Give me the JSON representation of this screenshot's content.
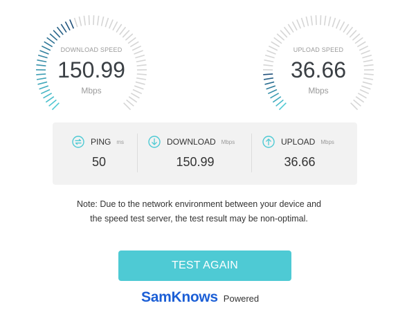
{
  "download_gauge": {
    "label": "DOWNLOAD SPEED",
    "value": "150.99",
    "unit": "Mbps",
    "fill_fraction": 0.43
  },
  "upload_gauge": {
    "label": "UPLOAD SPEED",
    "value": "36.66",
    "unit": "Mbps",
    "fill_fraction": 0.17
  },
  "stats": {
    "ping": {
      "label": "PING",
      "unit": "ms",
      "value": "50"
    },
    "download": {
      "label": "DOWNLOAD",
      "unit": "Mbps",
      "value": "150.99"
    },
    "upload": {
      "label": "UPLOAD",
      "unit": "Mbps",
      "value": "36.66"
    }
  },
  "note": {
    "line1": "Note: Due to the network environment between your device and",
    "line2": "the speed test server, the test result may be non-optimal."
  },
  "button": {
    "label": "TEST AGAIN"
  },
  "brand": {
    "logo": "SamKnows",
    "powered": "Powered"
  },
  "colors": {
    "accent": "#4ecad4",
    "gauge_dark": "#1f4f7a",
    "gauge_inactive": "#d5d5d5",
    "brand": "#1c5fd6"
  },
  "icons": {
    "ping": "ping-arrows-icon",
    "download": "download-arrow-icon",
    "upload": "upload-arrow-icon"
  }
}
